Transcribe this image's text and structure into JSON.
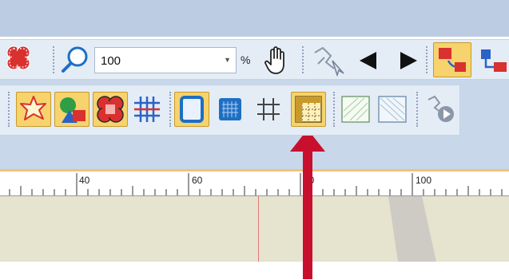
{
  "zoom": {
    "value": "100",
    "unit": "%"
  },
  "ruler": {
    "labels": [
      "40",
      "60",
      "80",
      "100"
    ]
  },
  "icons": {
    "toolbar1": [
      "shape-select-icon",
      "zoom-icon",
      "pan-hand-icon",
      "magic-wand-icon",
      "previous-arrow-icon",
      "next-arrow-icon",
      "color-sort-icon",
      "color-sort-alt-icon"
    ],
    "toolbar2": [
      "appliqué-icon",
      "shapes-icon",
      "fill-design-icon",
      "grid-fill-icon",
      "hoop-icon",
      "fabric-icon",
      "grid-icon",
      "ruler-grid-icon",
      "hatch-fill-icon",
      "hatch-fill-alt-icon",
      "stitch-player-icon"
    ]
  },
  "colors": {
    "title_band": "#bccde3",
    "toolbar_bg": "#e4ecf6",
    "active_button": "#f6d36c",
    "annotation_arrow": "#c8102e",
    "canvas": "#e6e3ce"
  }
}
